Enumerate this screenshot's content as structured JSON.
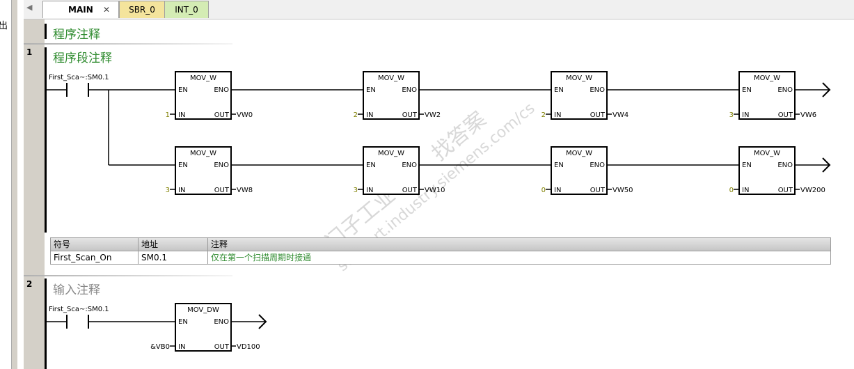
{
  "left_panel": {
    "glyph": "出"
  },
  "tabs": {
    "main": "MAIN",
    "close_glyph": "✕",
    "sbr": "SBR_0",
    "int": "INT_0"
  },
  "program_comment": "程序注释",
  "networks": [
    {
      "number": "1",
      "comment": "程序段注释",
      "contact": {
        "label": "First_Sca~:SM0.1"
      },
      "rows": [
        {
          "boxes": [
            {
              "title": "MOV_W",
              "en": "EN",
              "eno": "ENO",
              "in_label": "IN",
              "out_label": "OUT",
              "in_value": "1",
              "out_value": "VW0"
            },
            {
              "title": "MOV_W",
              "en": "EN",
              "eno": "ENO",
              "in_label": "IN",
              "out_label": "OUT",
              "in_value": "2",
              "out_value": "VW2"
            },
            {
              "title": "MOV_W",
              "en": "EN",
              "eno": "ENO",
              "in_label": "IN",
              "out_label": "OUT",
              "in_value": "2",
              "out_value": "VW4"
            },
            {
              "title": "MOV_W",
              "en": "EN",
              "eno": "ENO",
              "in_label": "IN",
              "out_label": "OUT",
              "in_value": "3",
              "out_value": "VW6"
            }
          ]
        },
        {
          "boxes": [
            {
              "title": "MOV_W",
              "en": "EN",
              "eno": "ENO",
              "in_label": "IN",
              "out_label": "OUT",
              "in_value": "3",
              "out_value": "VW8"
            },
            {
              "title": "MOV_W",
              "en": "EN",
              "eno": "ENO",
              "in_label": "IN",
              "out_label": "OUT",
              "in_value": "3",
              "out_value": "VW10"
            },
            {
              "title": "MOV_W",
              "en": "EN",
              "eno": "ENO",
              "in_label": "IN",
              "out_label": "OUT",
              "in_value": "0",
              "out_value": "VW50"
            },
            {
              "title": "MOV_W",
              "en": "EN",
              "eno": "ENO",
              "in_label": "IN",
              "out_label": "OUT",
              "in_value": "0",
              "out_value": "VW200"
            }
          ]
        }
      ],
      "symbol_table": {
        "headers": [
          "符号",
          "地址",
          "注释"
        ],
        "rows": [
          [
            "First_Scan_On",
            "SM0.1",
            "仅在第一个扫描周期时接通"
          ]
        ]
      }
    },
    {
      "number": "2",
      "comment": "输入注释",
      "contact": {
        "label": "First_Sca~:SM0.1"
      },
      "rows": [
        {
          "boxes": [
            {
              "title": "MOV_DW",
              "en": "EN",
              "eno": "ENO",
              "in_label": "IN",
              "out_label": "OUT",
              "in_value": "&VB0",
              "out_value": "VD100"
            }
          ]
        }
      ]
    }
  ],
  "watermark": {
    "line1": "西门子工业",
    "line2": "找答案",
    "line3": "support.industry.siemens.com/cs"
  },
  "colors": {
    "comment_green": "#2e8b2e",
    "value_olive": "#808000",
    "tab_sbr": "#f4e49c",
    "tab_int": "#d4ecb4"
  }
}
